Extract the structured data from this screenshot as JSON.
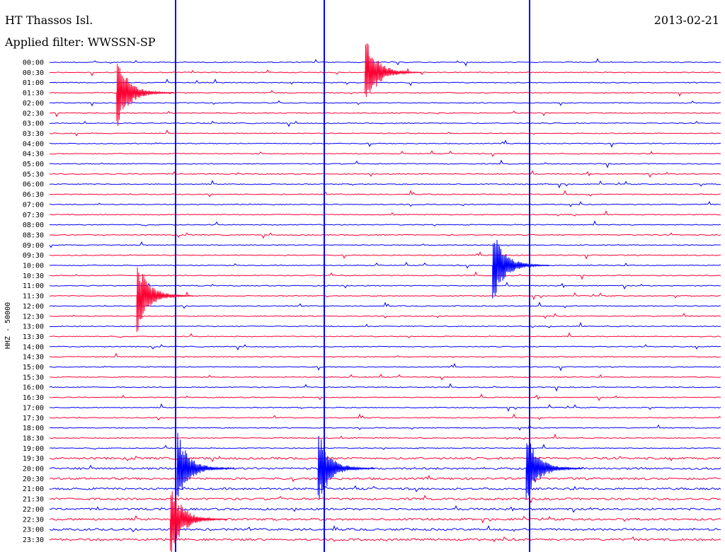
{
  "header": {
    "station": "HT Thassos Isl.",
    "filter": "Applied filter: WWSSN-SP",
    "date": "2013-02-21"
  },
  "chart_data": {
    "type": "line",
    "title": "HT Thassos Isl.",
    "ylabel": "HHZ - 50000",
    "row_labels": [
      "00:00",
      "00:30",
      "01:00",
      "01:30",
      "02:00",
      "02:30",
      "03:00",
      "03:30",
      "04:00",
      "04:30",
      "05:00",
      "05:30",
      "06:00",
      "06:30",
      "07:00",
      "07:30",
      "08:00",
      "08:30",
      "09:00",
      "09:30",
      "10:00",
      "10:30",
      "11:00",
      "11:30",
      "12:00",
      "12:30",
      "13:00",
      "13:30",
      "14:00",
      "14:30",
      "15:00",
      "15:30",
      "16:00",
      "16:30",
      "17:00",
      "17:30",
      "18:00",
      "18:30",
      "19:00",
      "19:30",
      "20:00",
      "20:30",
      "21:00",
      "21:30",
      "22:00",
      "22:30",
      "23:00",
      "23:30"
    ],
    "colors": {
      "even": "#0000ff",
      "odd": "#ff0033"
    },
    "major_events": [
      {
        "row": "01:30",
        "position": 0.1
      },
      {
        "row": "20:00",
        "position": 0.19
      },
      {
        "row": "20:00",
        "position": 0.4
      },
      {
        "row": "20:00",
        "position": 0.71
      },
      {
        "row": "22:30",
        "position": 0.18
      },
      {
        "row": "10:00",
        "position": 0.66
      },
      {
        "row": "00:30",
        "position": 0.47
      },
      {
        "row": "11:30",
        "position": 0.13
      }
    ]
  }
}
